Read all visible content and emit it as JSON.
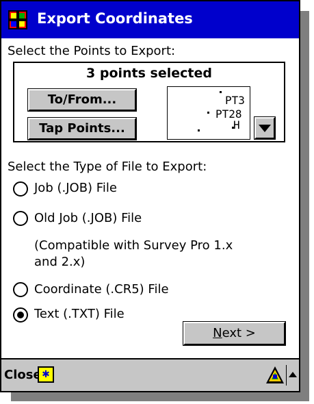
{
  "window": {
    "title": "Export Coordinates",
    "app_icon": "survey-app-icon",
    "title_bar_color": "#0000cc"
  },
  "points_section": {
    "label": "Select the Points to Export:",
    "selected_count": "3 points selected",
    "to_from_button": "To/From...",
    "tap_points_button": "Tap Points...",
    "preview_labels": [
      "PT3",
      "PT28",
      "H"
    ],
    "dropdown_icon": "triangle-down-icon"
  },
  "file_type_section": {
    "label": "Select the Type of File to Export:",
    "options": [
      {
        "label": "Job (.JOB) File",
        "selected": false
      },
      {
        "label": "Old Job (.JOB) File",
        "selected": false
      },
      {
        "label": "Coordinate (.CR5) File",
        "selected": false
      },
      {
        "label": "Text (.TXT) File",
        "selected": true
      }
    ],
    "old_job_note_line1": "(Compatible with Survey Pro 1.x",
    "old_job_note_line2": "and 2.x)"
  },
  "next_button": {
    "mnemonic": "N",
    "rest": "ext >"
  },
  "bottom_bar": {
    "close_label": "Close",
    "sip_icon": "keyboard-icon",
    "tray_icon": "triangle-satellite-icon",
    "menu_icon": "up-arrow-icon"
  }
}
